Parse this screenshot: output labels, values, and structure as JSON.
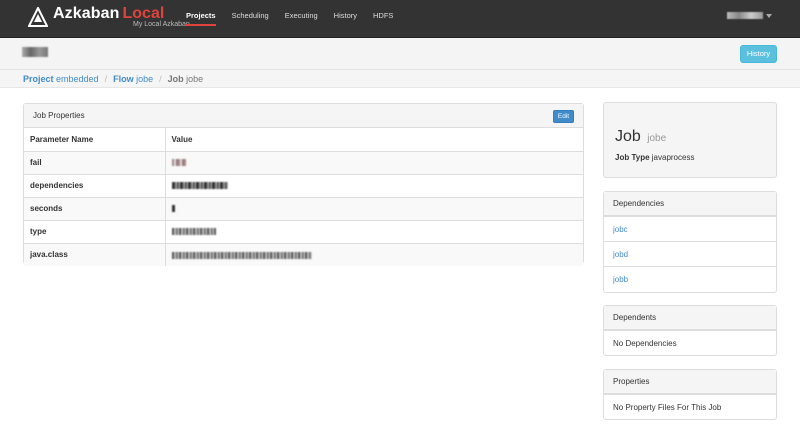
{
  "navbar": {
    "brand": "Azkaban",
    "env": "Local",
    "subtitle": "My Local Azkaban",
    "items": [
      {
        "label": "Projects",
        "active": true
      },
      {
        "label": "Scheduling",
        "active": false
      },
      {
        "label": "Executing",
        "active": false
      },
      {
        "label": "History",
        "active": false
      },
      {
        "label": "HDFS",
        "active": false
      }
    ]
  },
  "header": {
    "history_label": "History"
  },
  "breadcrumb": {
    "project_label": "Project",
    "project_name": "embedded",
    "flow_label": "Flow",
    "flow_name": "jobe",
    "job_label": "Job",
    "job_name": "jobe",
    "separator": "/"
  },
  "properties": {
    "title": "Job Properties",
    "edit_label": "Edit",
    "columns": [
      "Parameter Name",
      "Value"
    ],
    "rows": [
      {
        "name": "fail"
      },
      {
        "name": "dependencies"
      },
      {
        "name": "seconds"
      },
      {
        "name": "type"
      },
      {
        "name": "java.class"
      }
    ]
  },
  "job_card": {
    "title": "Job",
    "name": "jobe",
    "type_label": "Job Type",
    "type_value": "javaprocess"
  },
  "dependencies": {
    "title": "Dependencies",
    "items": [
      "jobc",
      "jobd",
      "jobb"
    ]
  },
  "dependents": {
    "title": "Dependents",
    "empty": "No Dependencies"
  },
  "props_files": {
    "title": "Properties",
    "empty": "No Property Files For This Job"
  },
  "colors": {
    "navbar": "#333333",
    "accent": "#e0433c",
    "link": "#428bca",
    "history_button": "#5bc0de"
  }
}
